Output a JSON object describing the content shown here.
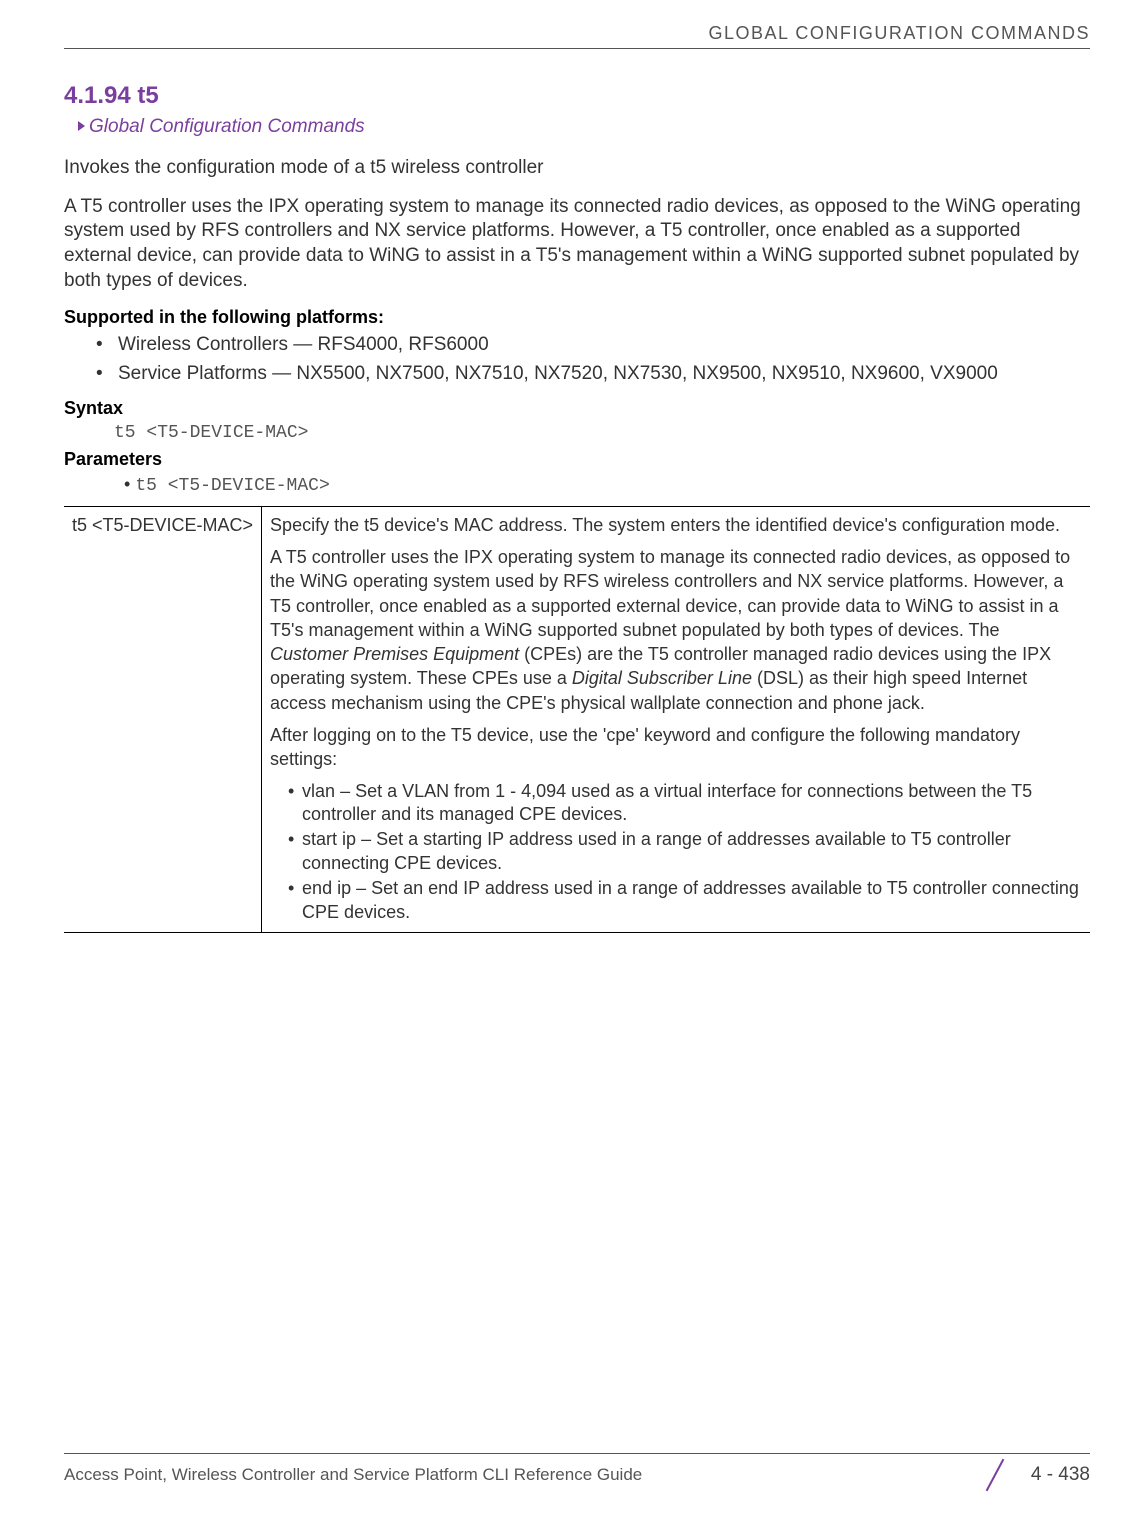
{
  "header": "GLOBAL CONFIGURATION COMMANDS",
  "section": {
    "number": "4.1.94 t5",
    "breadcrumb": "Global Configuration Commands",
    "intro1": "Invokes the configuration mode of a t5 wireless controller",
    "intro2": "A T5 controller uses the IPX operating system to manage its connected radio devices, as opposed to the WiNG operating system used by RFS controllers and NX service platforms. However, a T5 controller, once enabled as a supported external device, can provide data to WiNG to assist in a T5's management within a WiNG supported subnet populated by both types of devices."
  },
  "supported": {
    "heading": "Supported in the following platforms:",
    "items": [
      "Wireless Controllers — RFS4000, RFS6000",
      "Service Platforms — NX5500, NX7500, NX7510, NX7520, NX7530, NX9500, NX9510, NX9600, VX9000"
    ]
  },
  "syntax": {
    "heading": "Syntax",
    "value": "t5 <T5-DEVICE-MAC>"
  },
  "parameters": {
    "heading": "Parameters",
    "bullet": "t5 <T5-DEVICE-MAC>",
    "param_name": "t5 <T5-DEVICE-MAC>",
    "desc1": "Specify the t5 device's MAC address. The system enters the identified device's configuration mode.",
    "desc2_a": "A T5 controller uses the IPX operating system to manage its connected radio devices, as opposed to the WiNG operating system used by RFS wireless controllers and NX service platforms. However, a T5 controller, once enabled as a supported external device, can provide data to WiNG to assist in a T5's management within a WiNG supported subnet populated by both types of devices. The ",
    "desc2_i1": "Customer Premises Equipment",
    "desc2_b": " (CPEs) are the T5 controller managed radio devices using the IPX operating system. These CPEs use a ",
    "desc2_i2": "Digital Subscriber Line",
    "desc2_c": " (DSL) as their high speed Internet access mechanism using the CPE's physical wallplate connection and phone jack.",
    "desc3": "After logging on to the T5 device, use the 'cpe' keyword and configure the following mandatory settings:",
    "settings": [
      "vlan – Set a VLAN from 1 - 4,094 used as a virtual interface for connections between the T5 controller and its managed CPE devices.",
      "start ip – Set a starting IP address used in a range of addresses available to T5 controller connecting CPE devices.",
      "end ip – Set an end IP address used in a range of addresses available to T5 controller connecting CPE devices."
    ]
  },
  "footer": {
    "left": "Access Point, Wireless Controller and Service Platform CLI Reference Guide",
    "right": "4 - 438"
  }
}
